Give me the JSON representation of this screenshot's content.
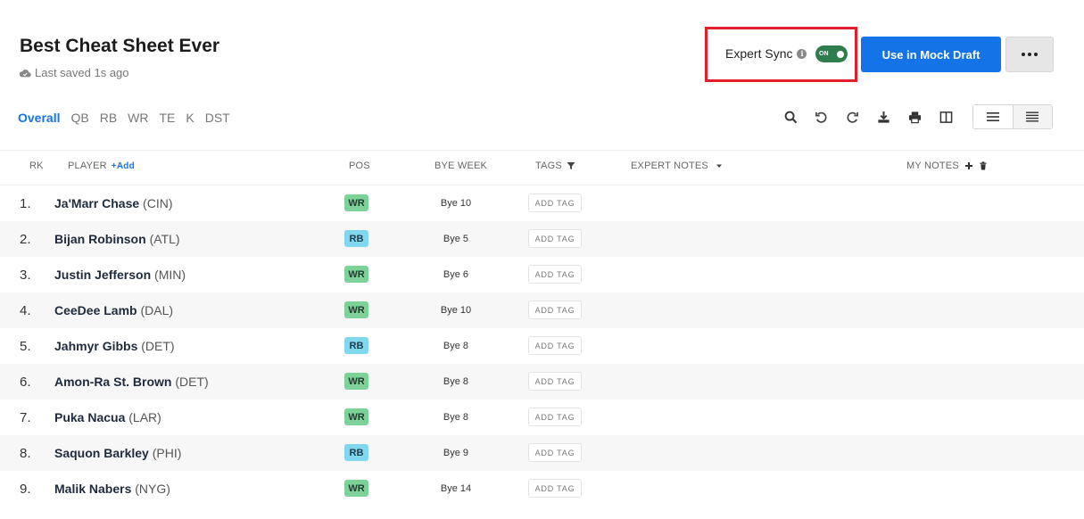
{
  "header": {
    "title": "Best Cheat Sheet Ever",
    "saved_status": "Last saved 1s ago",
    "expert_sync_label": "Expert Sync",
    "toggle_state": "ON",
    "mock_draft_button": "Use in Mock Draft"
  },
  "icons": {
    "saved": "cloud-icon",
    "info": "info-icon",
    "more": "ellipsis-icon",
    "search": "search-icon",
    "undo": "undo-icon",
    "redo": "redo-icon",
    "download": "download-icon",
    "print": "print-icon",
    "columns": "columns-icon",
    "list_view": "list-icon",
    "compact_view": "compact-list-icon",
    "filter": "filter-icon",
    "sort": "caret-down-icon",
    "add_note": "plus-icon",
    "delete_notes": "trash-icon"
  },
  "colors": {
    "accent": "#1473e6",
    "toggle_on": "#2e7d4f",
    "highlight_box": "#e0202c",
    "wr_badge": "#7fd19a",
    "rb_badge": "#7fd8ee"
  },
  "tabs": [
    "Overall",
    "QB",
    "RB",
    "WR",
    "TE",
    "K",
    "DST"
  ],
  "active_tab": "Overall",
  "table": {
    "columns": {
      "rk": "RK",
      "player": "PLAYER",
      "add_player": "+Add",
      "pos": "POS",
      "bye_week": "BYE WEEK",
      "tags": "TAGS",
      "expert_notes": "EXPERT NOTES",
      "my_notes": "MY NOTES"
    },
    "add_tag_label": "ADD TAG",
    "rows": [
      {
        "rank": "1.",
        "name": "Ja'Marr Chase",
        "team": "(CIN)",
        "pos": "WR",
        "bye": "Bye 10"
      },
      {
        "rank": "2.",
        "name": "Bijan Robinson",
        "team": "(ATL)",
        "pos": "RB",
        "bye": "Bye 5"
      },
      {
        "rank": "3.",
        "name": "Justin Jefferson",
        "team": "(MIN)",
        "pos": "WR",
        "bye": "Bye 6"
      },
      {
        "rank": "4.",
        "name": "CeeDee Lamb",
        "team": "(DAL)",
        "pos": "WR",
        "bye": "Bye 10"
      },
      {
        "rank": "5.",
        "name": "Jahmyr Gibbs",
        "team": "(DET)",
        "pos": "RB",
        "bye": "Bye 8"
      },
      {
        "rank": "6.",
        "name": "Amon-Ra St. Brown",
        "team": "(DET)",
        "pos": "WR",
        "bye": "Bye 8"
      },
      {
        "rank": "7.",
        "name": "Puka Nacua",
        "team": "(LAR)",
        "pos": "WR",
        "bye": "Bye 8"
      },
      {
        "rank": "8.",
        "name": "Saquon Barkley",
        "team": "(PHI)",
        "pos": "RB",
        "bye": "Bye 9"
      },
      {
        "rank": "9.",
        "name": "Malik Nabers",
        "team": "(NYG)",
        "pos": "WR",
        "bye": "Bye 14"
      }
    ]
  }
}
